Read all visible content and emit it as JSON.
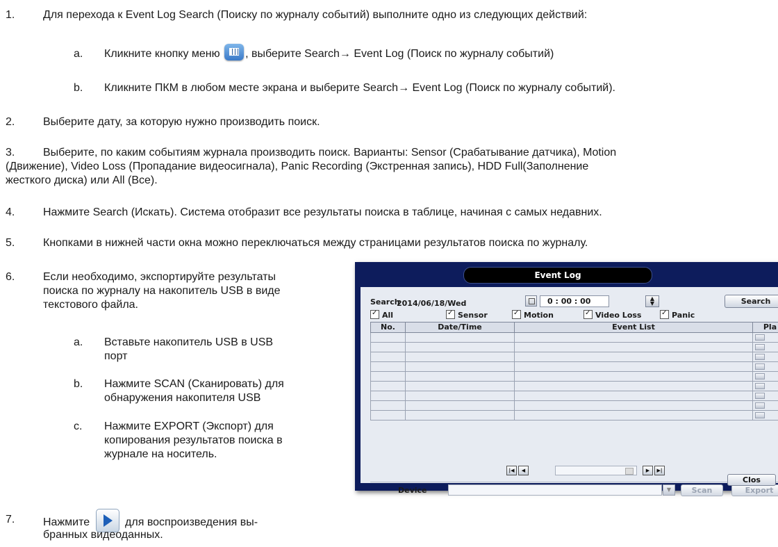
{
  "steps": [
    {
      "n": "1.",
      "text": "Для перехода к Event Log Search (Поиску по журналу событий) выполните одно из следующих действий:"
    },
    {
      "n": "2.",
      "text": "Выберите дату, за которую нужно производить поиск."
    },
    {
      "n": "3.",
      "text_line1": "Выберите, по каким событиям журнала производить поиск. Варианты: Sensor (Срабатывание датчика), Motion",
      "text_line2": "(Движение), Video Loss (Пропадание видеосигнала), Panic Recording (Экстренная запись), HDD Full(Заполнение",
      "text_line3": "жесткого диска) или All (Все)."
    },
    {
      "n": "4.",
      "text": "Нажмите Search (Искать). Система отобразит все результаты поиска в таблице, начиная с самых недавних."
    },
    {
      "n": "5.",
      "text": "Кнопками в нижней части окна можно переключаться между страницами результатов поиска по журналу."
    },
    {
      "n": "6.",
      "text_line1": "Если необходимо, экспортируйте результаты",
      "text_line2": "поиска по журналу на накопитель USB в виде",
      "text_line3": "текстового файла."
    },
    {
      "n": "7.",
      "text_before": "Нажмите",
      "text_after": "для воспроизведения вы-",
      "text_line2": "бранных видеоданных."
    }
  ],
  "substeps_1": [
    {
      "l": "a.",
      "before": "Кликните кнопку меню",
      "after": ", выберите Search→ Event Log (Поиск по журналу событий)"
    },
    {
      "l": "b.",
      "text": "Кликните ПКМ в любом месте экрана и выберите Search→ Event Log (Поиск по журналу событий)."
    }
  ],
  "substeps_6": [
    {
      "l": "a.",
      "line1": "Вставьте накопитель USB в USB",
      "line2": "порт"
    },
    {
      "l": "b.",
      "line1": "Нажмите SCAN (Сканировать) для",
      "line2": "обнаружения накопителя USB"
    },
    {
      "l": "c.",
      "line1": "Нажмите EXPORT (Экспорт) для",
      "line2": "копирования результатов поиска в",
      "line3": "журнале на носитель."
    }
  ],
  "icons": {
    "menu": "menu-grid-icon",
    "play": "play-icon"
  },
  "event_log": {
    "title": "Event Log",
    "search_label": "Search",
    "date": "2014/06/18/Wed",
    "time": "0  : 00 : 00",
    "search_button": "Search",
    "checkboxes": [
      "All",
      "Sensor",
      "Motion",
      "Video Loss",
      "Panic"
    ],
    "columns": [
      "No.",
      "Date/Time",
      "Event List",
      "Pla"
    ],
    "device_label": "Device",
    "scan_button": "Scan",
    "export_button": "Export",
    "close_button": "Clos"
  }
}
